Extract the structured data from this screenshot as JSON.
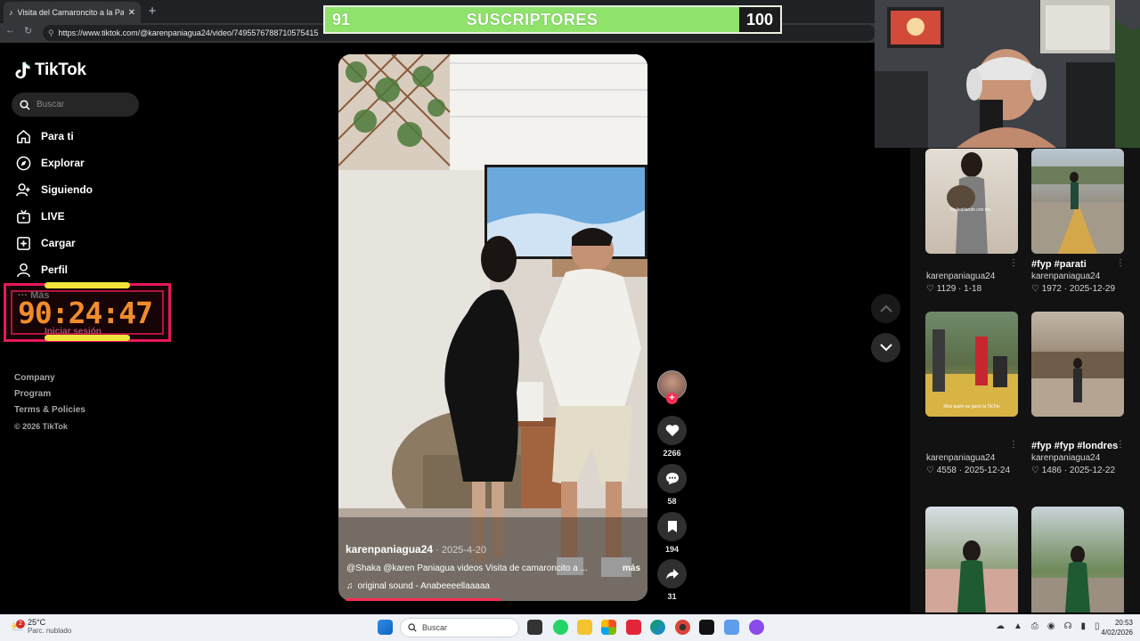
{
  "browser": {
    "tab_title": "Visita del Camaroncito a la Pastelería",
    "url": "https://www.tiktok.com/@karenpaniagua24/video/7495576788710575415"
  },
  "subscriber_bar": {
    "current": "91",
    "label": "SUSCRIPTORES",
    "goal": "100",
    "progress": 0.91
  },
  "sidebar": {
    "logo": "TikTok",
    "search_placeholder": "Buscar",
    "items": [
      {
        "label": "Para ti",
        "icon": "home-icon"
      },
      {
        "label": "Explorar",
        "icon": "compass-icon"
      },
      {
        "label": "Siguiendo",
        "icon": "following-icon"
      },
      {
        "label": "LIVE",
        "icon": "live-icon"
      },
      {
        "label": "Cargar",
        "icon": "upload-icon"
      },
      {
        "label": "Perfil",
        "icon": "profile-icon"
      }
    ],
    "more_label": "Más",
    "login_label": "Iniciar sesión",
    "footer": [
      "Company",
      "Program",
      "Terms & Policies"
    ],
    "copyright": "© 2026 TikTok"
  },
  "timer": {
    "value": "90:24:47",
    "color": "#f08c2e",
    "frame_color": "#e8185a"
  },
  "video": {
    "username": "karenpaniagua24",
    "date": "· 2025-4-20",
    "description": "@Shaka @karen Paniagua videos Visita de camaroncito a ...",
    "more": "más",
    "sound": "original sound - Anabeeeellaaaaa",
    "progress": 0.5
  },
  "actions": {
    "likes": "2266",
    "comments": "58",
    "saves": "194",
    "shares": "31"
  },
  "right_grid": [
    {
      "title": "",
      "user": "karenpaniagua24",
      "views": "1129",
      "date": "1-18",
      "overlay": "Pa hablando con mi..."
    },
    {
      "title": "#fyp #parati",
      "user": "karenpaniagua24",
      "views": "1972",
      "date": "2025-12-29",
      "overlay": ""
    },
    {
      "title": "",
      "user": "karenpaniagua24",
      "views": "4558",
      "date": "2025-12-24",
      "overlay": "Mira quién se ganó la TikTok"
    },
    {
      "title": "#fyp #fyp #londres",
      "user": "karenpaniagua24",
      "views": "1486",
      "date": "2025-12-22",
      "overlay": ""
    },
    {
      "title": "",
      "user": "",
      "views": "",
      "date": "",
      "overlay": ""
    },
    {
      "title": "",
      "user": "",
      "views": "",
      "date": "",
      "overlay": ""
    }
  ],
  "taskbar": {
    "temperature": "25°C",
    "weather": "Parc. nublado",
    "weather_badge": "2",
    "search_label": "Buscar",
    "time": "20:53",
    "date": "4/02/2026"
  },
  "colors": {
    "accent": "#fe2c55",
    "progress_green": "#8fe36b",
    "taskbar": "#eef1f6"
  }
}
